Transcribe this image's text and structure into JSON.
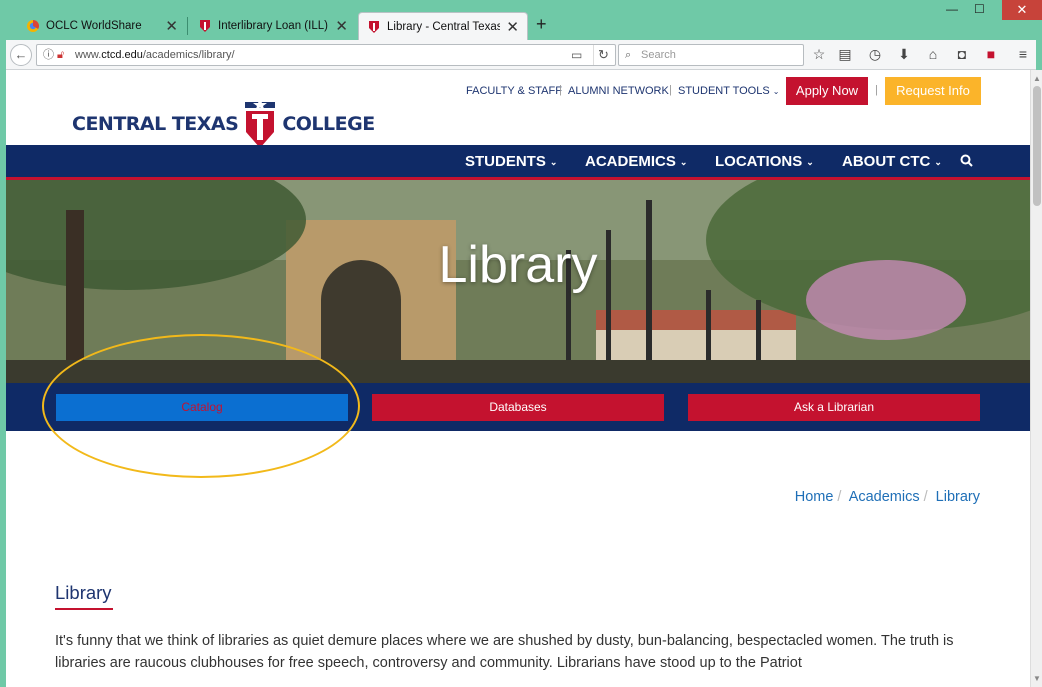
{
  "browser": {
    "tabs": [
      {
        "title": "OCLC WorldShare",
        "favicon": "oclc-icon"
      },
      {
        "title": "Interlibrary Loan (ILL) - Ce...",
        "favicon": "ctc-icon"
      },
      {
        "title": "Library - Central Texas Col...",
        "favicon": "ctc-icon",
        "active": true
      }
    ],
    "url": {
      "prefix": "www.",
      "host": "ctcd.edu",
      "path": "/academics/library/"
    },
    "search_placeholder": "Search"
  },
  "header": {
    "utility_links": [
      "FACULTY & STAFF",
      "ALUMNI NETWORK",
      "STUDENT TOOLS"
    ],
    "apply_label": "Apply Now",
    "request_label": "Request Info",
    "logo": {
      "left": "CENTRAL TEXAS",
      "right": "COLLEGE"
    }
  },
  "mainnav": {
    "items": [
      "STUDENTS",
      "ACADEMICS",
      "LOCATIONS",
      "ABOUT CTC"
    ]
  },
  "hero": {
    "title": "Library"
  },
  "quicklinks": {
    "catalog": "Catalog",
    "databases": "Databases",
    "ask": "Ask a Librarian"
  },
  "breadcrumb": [
    "Home",
    "Academics",
    "Library"
  ],
  "content": {
    "title": "Library",
    "paragraph": "It's funny that we think of libraries as quiet demure places where we are shushed by dusty, bun-balancing, bespectacled women. The truth is libraries are raucous clubhouses for free speech, controversy and community. Librarians have stood up to the Patriot"
  },
  "colors": {
    "navy": "#0f2a66",
    "red": "#c4122f",
    "gold": "#fbb42a",
    "link_blue": "#1f6fb7",
    "highlight": "#f2b91a"
  }
}
